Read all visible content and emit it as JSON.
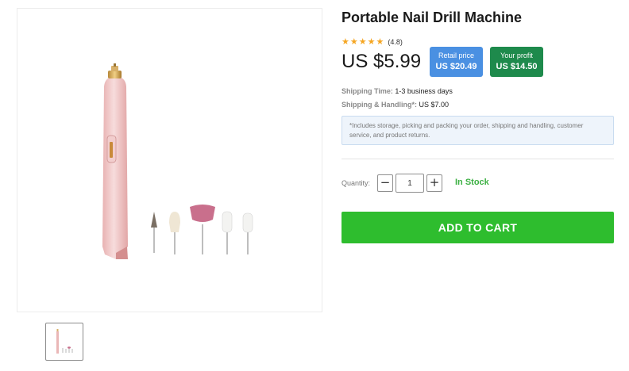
{
  "product": {
    "title": "Portable Nail Drill Machine",
    "rating_value": "(4.8)",
    "star_count": 5,
    "price": "US $5.99"
  },
  "badges": {
    "retail_label": "Retail price",
    "retail_value": "US $20.49",
    "profit_label": "Your profit",
    "profit_value": "US $14.50"
  },
  "shipping": {
    "time_label": "Shipping Time:",
    "time_value": "1-3 business days",
    "handling_label": "Shipping & Handling*:",
    "handling_value": "US $7.00",
    "note": "*Includes storage, picking and packing your order, shipping and handling, customer service, and product returns."
  },
  "purchase": {
    "quantity_label": "Quantity:",
    "minus": "−",
    "plus": "+",
    "quantity_value": "1",
    "stock_status": "In Stock",
    "add_to_cart_label": "ADD TO CART"
  },
  "colors": {
    "accent_green": "#2ebd2e",
    "retail_blue": "#4a90e2",
    "profit_green": "#1e8a4c",
    "star": "#f5a623",
    "stock_green": "#3cb043"
  }
}
